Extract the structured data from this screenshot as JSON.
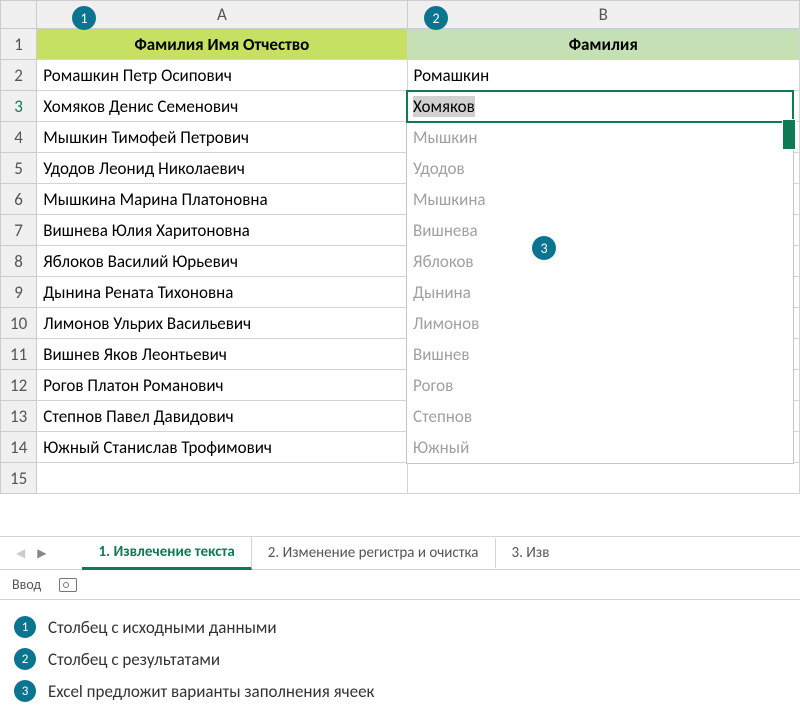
{
  "columns": {
    "a_letter": "A",
    "b_letter": "B"
  },
  "headers": {
    "col_a": "Фамилия Имя Отчество",
    "col_b": "Фамилия"
  },
  "rows": [
    {
      "n": "2",
      "a": "Ромашкин Петр Осипович",
      "b": "Ромашкин"
    },
    {
      "n": "3",
      "a": "Хомяков Денис Семенович",
      "b": "Хомяков"
    },
    {
      "n": "4",
      "a": "Мышкин Тимофей Петрович",
      "b": "Мышкин"
    },
    {
      "n": "5",
      "a": "Удодов Леонид Николаевич",
      "b": "Удодов"
    },
    {
      "n": "6",
      "a": "Мышкина Марина Платоновна",
      "b": "Мышкина"
    },
    {
      "n": "7",
      "a": "Вишнева Юлия Харитоновна",
      "b": "Вишнева"
    },
    {
      "n": "8",
      "a": "Яблоков Василий Юрьевич",
      "b": "Яблоков"
    },
    {
      "n": "9",
      "a": "Дынина Рената Тихоновна",
      "b": "Дынина"
    },
    {
      "n": "10",
      "a": "Лимонов Ульрих Васильевич",
      "b": "Лимонов"
    },
    {
      "n": "11",
      "a": "Вишнев Яков Леонтьевич",
      "b": "Вишнев"
    },
    {
      "n": "12",
      "a": "Рогов Платон Романович",
      "b": "Рогов"
    },
    {
      "n": "13",
      "a": "Степнов Павел Давидович",
      "b": "Степнов"
    },
    {
      "n": "14",
      "a": "Южный Станислав Трофимович",
      "b": "Южный"
    }
  ],
  "extra_row": "15",
  "active_row_index": 1,
  "tabs": {
    "active": "1. Извлечение текста",
    "second": "2. Изменение регистра и очистка",
    "third": "3. Изв"
  },
  "status": {
    "mode": "Ввод"
  },
  "callouts": {
    "c1": "1",
    "c2": "2",
    "c3": "3"
  },
  "legend": {
    "l1": "Столбец с исходными данными",
    "l2": "Столбец с результатами",
    "l3": "Excel предложит варианты заполнения ячеек"
  },
  "colors": {
    "teal": "#0b7591",
    "excel_green": "#0f7b55",
    "header_a": "#c5e063",
    "header_b": "#c5e0b4"
  }
}
